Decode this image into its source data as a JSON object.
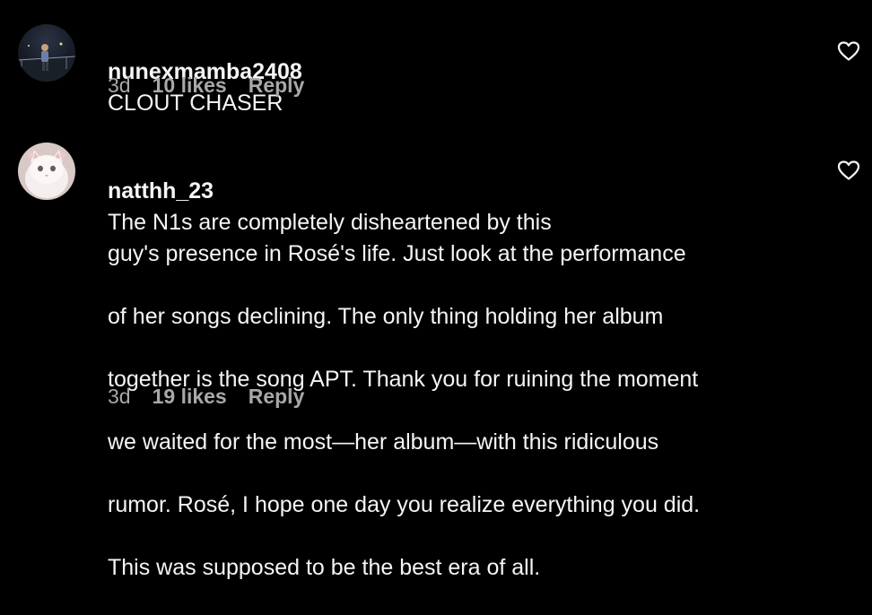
{
  "colors": {
    "background": "#000000",
    "text": "#f5f5f5",
    "meta": "#a8a8a8"
  },
  "comments": [
    {
      "username": "nunexmamba2408",
      "text": "CLOUT CHASER",
      "age": "3d",
      "likes": "10 likes",
      "reply": "Reply",
      "avatar_icon": "avatar-photo-person-night",
      "like_icon": "heart-outline-icon"
    },
    {
      "username": "natthh_23",
      "text": "The N1s are completely disheartened by this guy's presence in Rosé's life. Just look at the performance of her songs declining. The only thing holding her album together is the song APT. Thank you for ruining the moment we waited for the most—her album—with this ridiculous rumor. Rosé, I hope one day you realize everything you did. This was supposed to be the best era of all.",
      "text_lines": [
        "The N1s are completely disheartened by this",
        "guy's presence in Rosé's life. Just look at the performance",
        "of her songs declining. The only thing holding her album",
        "together is the song APT. Thank you for ruining the moment",
        "we waited for the most—her album—with this ridiculous",
        "rumor. Rosé, I hope one day you realize everything you did.",
        "This was supposed to be the best era of all."
      ],
      "age": "3d",
      "likes": "19 likes",
      "reply": "Reply",
      "avatar_icon": "avatar-photo-white-cat",
      "like_icon": "heart-outline-icon"
    }
  ]
}
